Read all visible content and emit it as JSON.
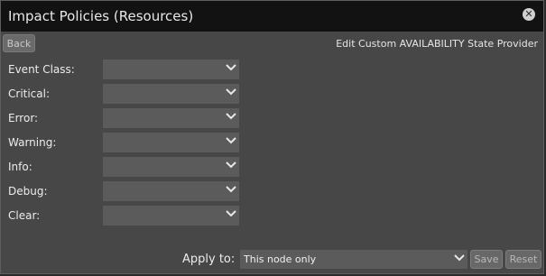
{
  "dialog": {
    "title": "Impact Policies (Resources)",
    "close_icon": "close-circle-icon"
  },
  "header": {
    "back_label": "Back",
    "subtitle": "Edit Custom AVAILABILITY State Provider"
  },
  "fields": [
    {
      "label": "Event Class:",
      "value": ""
    },
    {
      "label": "Critical:",
      "value": ""
    },
    {
      "label": "Error:",
      "value": ""
    },
    {
      "label": "Warning:",
      "value": ""
    },
    {
      "label": "Info:",
      "value": ""
    },
    {
      "label": "Debug:",
      "value": ""
    },
    {
      "label": "Clear:",
      "value": ""
    }
  ],
  "footer": {
    "apply_label": "Apply to:",
    "apply_value": "This node only",
    "save_label": "Save",
    "reset_label": "Reset"
  },
  "colors": {
    "titlebar": "#121212",
    "panel": "#474747",
    "select": "#5b5b5b"
  }
}
